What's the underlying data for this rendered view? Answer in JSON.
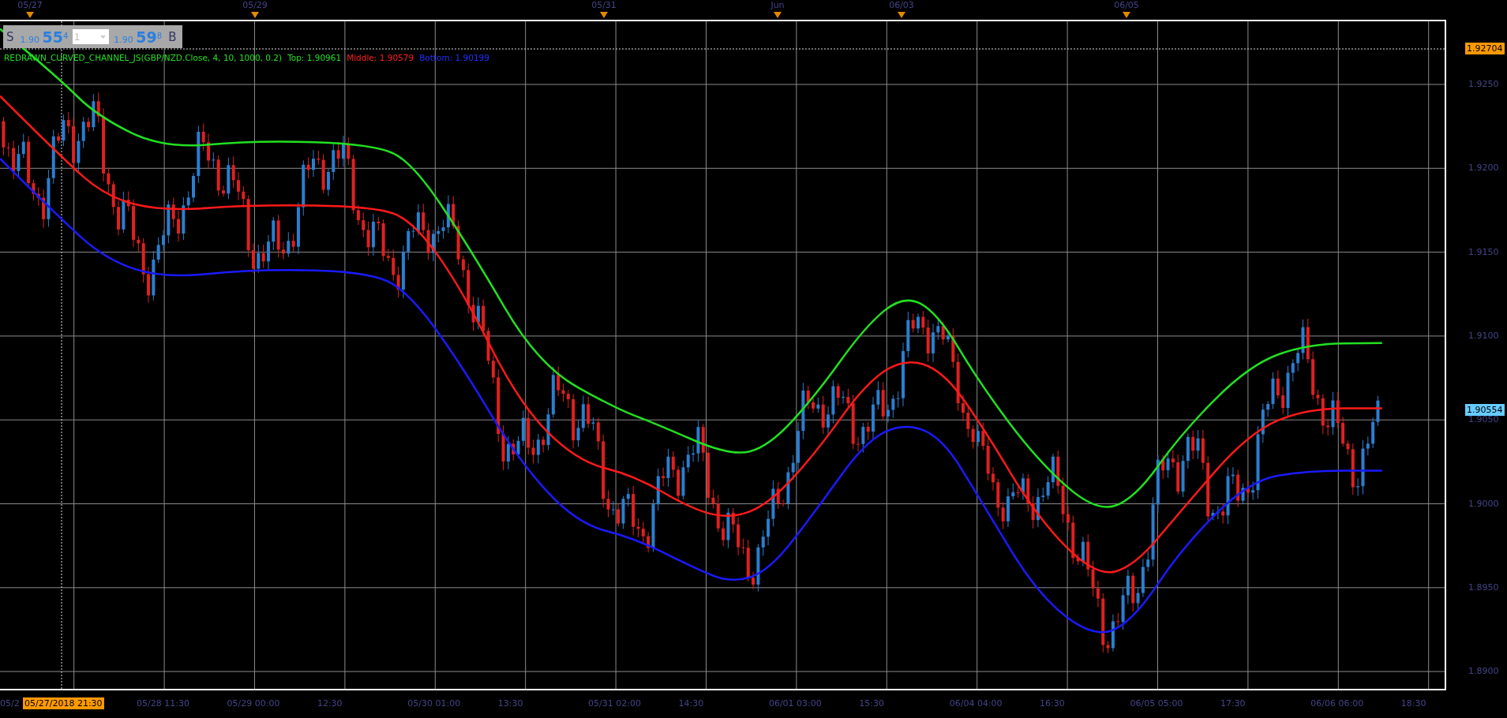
{
  "top_axis": {
    "dates": [
      "05/27",
      "05/29",
      "05/31",
      "Jun",
      "06/03",
      "06/05"
    ]
  },
  "trade_panel": {
    "sell_label": "S",
    "sell_prefix": "1.90",
    "sell_pips": "55",
    "sell_fraction": "4",
    "quantity": "1",
    "buy_prefix": "1.90",
    "buy_pips": "59",
    "buy_fraction": "8",
    "buy_label": "B"
  },
  "indicator_legend": [
    {
      "kind": "name",
      "text": "REDRAWN_CURVED_CHANNEL_JS(GBP/NZD.Close, 4, 10, 1000, 0.2)"
    },
    {
      "kind": "top",
      "text": "Top: 1.90961"
    },
    {
      "kind": "middle",
      "text": "Middle: 1.90579"
    },
    {
      "kind": "bottom",
      "text": "Bottom: 1.90199"
    }
  ],
  "price_axis": {
    "labels": [
      "1.9250",
      "1.9200",
      "1.9150",
      "1.9100",
      "1.9050",
      "1.9000",
      "1.8950",
      "1.8900"
    ],
    "tags": [
      {
        "kind": "crosshair",
        "text": "1.92704"
      },
      {
        "kind": "last",
        "text": "1.90554"
      }
    ]
  },
  "time_axis": {
    "cut_label": "05/2",
    "crosshair_label": "05/27/2018 21:30",
    "labels": [
      "05/28 11:30",
      "05/29 00:00",
      "12:30",
      "05/30 01:00",
      "13:30",
      "05/31 02:00",
      "14:30",
      "06/01 03:00",
      "15:30",
      "06/04 04:00",
      "16:30",
      "06/05 05:00",
      "17:30",
      "06/06 06:00",
      "18:30"
    ]
  }
}
